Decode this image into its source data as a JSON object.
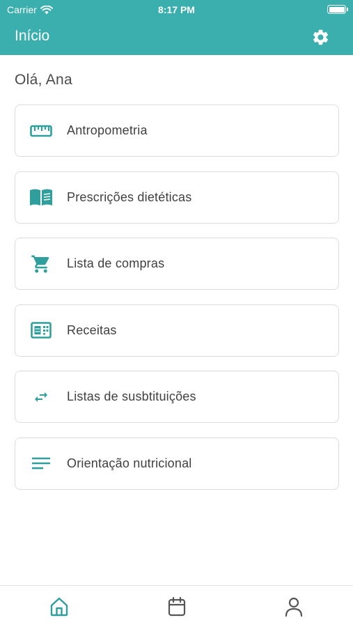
{
  "status_bar": {
    "carrier": "Carrier",
    "time": "8:17 PM",
    "wifi_icon": "wifi-icon",
    "battery_icon": "battery-full-icon"
  },
  "header": {
    "title": "Início",
    "settings_icon": "gear-icon",
    "background_color": "#3aafae"
  },
  "greeting": "Olá, Ana",
  "menu": {
    "items": [
      {
        "label": "Antropometria",
        "icon": "ruler-icon"
      },
      {
        "label": "Prescrições dietéticas",
        "icon": "book-icon"
      },
      {
        "label": "Lista de compras",
        "icon": "shopping-cart-icon"
      },
      {
        "label": "Receitas",
        "icon": "recipe-card-icon"
      },
      {
        "label": "Listas de susbtituições",
        "icon": "swap-arrows-icon"
      },
      {
        "label": "Orientação nutricional",
        "icon": "notes-lines-icon"
      }
    ],
    "icon_color": "#2e9f9d"
  },
  "tab_bar": {
    "tabs": [
      {
        "icon": "home-icon",
        "active": true
      },
      {
        "icon": "calendar-icon",
        "active": false
      },
      {
        "icon": "user-icon",
        "active": false
      }
    ],
    "active_color": "#2e9f9d",
    "inactive_color": "#555555"
  }
}
